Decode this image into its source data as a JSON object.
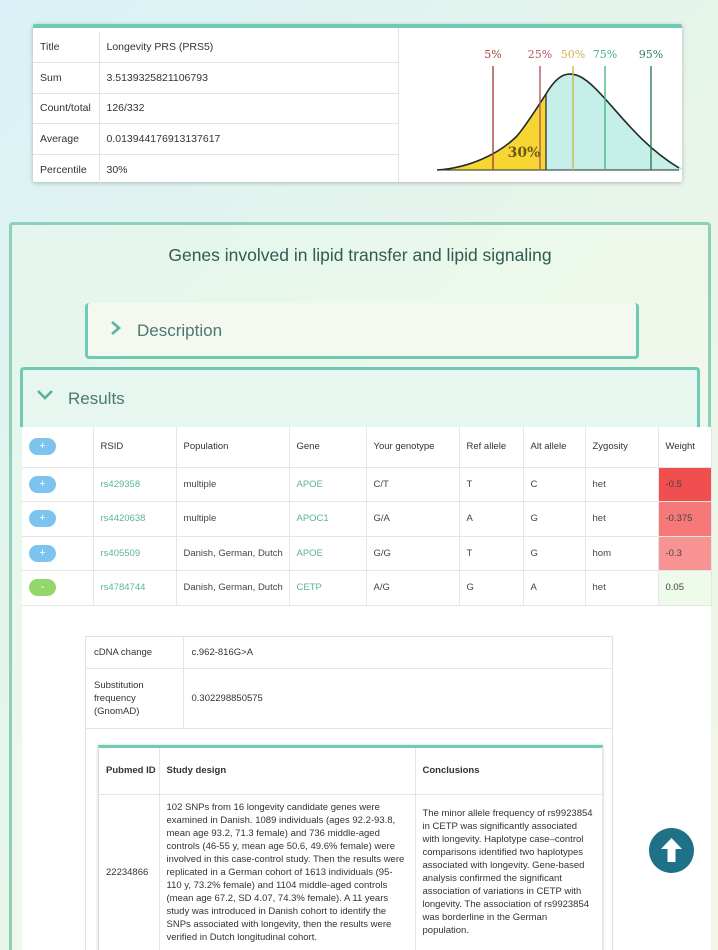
{
  "prs": {
    "rows": [
      {
        "label": "Title",
        "value": "Longevity PRS (PRS5)"
      },
      {
        "label": "Sum",
        "value": "3.5139325821106793"
      },
      {
        "label": "Count/total",
        "value": "126/332"
      },
      {
        "label": "Average",
        "value": "0.013944176913137617"
      },
      {
        "label": "Percentile",
        "value": "30%"
      }
    ],
    "chart": {
      "percentile_labels": [
        "5%",
        "25%",
        "50%",
        "75%",
        "95%"
      ],
      "percentile_colors": [
        "#a8433a",
        "#b4585f",
        "#cdb54a",
        "#46b582",
        "#2f7c55"
      ],
      "highlight_label": "30%",
      "highlight_fraction": 0.3,
      "fill_left": "#f7d633",
      "fill_right": "#c5efe8"
    }
  },
  "section": {
    "title": "Genes involved in lipid transfer and lipid signaling",
    "description_label": "Description",
    "results_label": "Results"
  },
  "results": {
    "headers": {
      "toggle": "+",
      "rsid": "RSID",
      "population": "Population",
      "gene": "Gene",
      "genotype": "Your genotype",
      "ref": "Ref allele",
      "alt": "Alt allele",
      "zygosity": "Zygosity",
      "weight": "Weight"
    },
    "rows": [
      {
        "toggle": "+",
        "rsid": "rs429358",
        "population": "multiple",
        "gene": "APOE",
        "genotype": "C/T",
        "ref": "T",
        "alt": "C",
        "zygosity": "het",
        "weight": "-0.5",
        "weight_color": "#f14f4f"
      },
      {
        "toggle": "+",
        "rsid": "rs4420638",
        "population": "multiple",
        "gene": "APOC1",
        "genotype": "G/A",
        "ref": "A",
        "alt": "G",
        "zygosity": "het",
        "weight": "-0.375",
        "weight_color": "#f67878"
      },
      {
        "toggle": "+",
        "rsid": "rs405509",
        "population": "Danish, German, Dutch",
        "gene": "APOE",
        "genotype": "G/G",
        "ref": "T",
        "alt": "G",
        "zygosity": "hom",
        "weight": "-0.3",
        "weight_color": "#f89393"
      },
      {
        "toggle": "-",
        "rsid": "rs4784744",
        "population": "Danish, German, Dutch",
        "gene": "CETP",
        "genotype": "A/G",
        "ref": "G",
        "alt": "A",
        "zygosity": "het",
        "weight": "0.05",
        "weight_color": "#eefaea"
      }
    ]
  },
  "detail": {
    "cdna_label": "cDNA change",
    "cdna_value": "c.962-816G>A",
    "freq_label": "Substitution frequency (GnomAD)",
    "freq_value": "0.302298850575",
    "pub_headers": {
      "id": "Pubmed ID",
      "design": "Study design",
      "conclusions": "Conclusions"
    },
    "pub_row": {
      "id": "22234866",
      "design": "102 SNPs from 16 longevity candidate genes were examined in Danish. 1089 individuals (ages 92.2-93.8, mean age 93.2, 71.3 female) and 736 middle-aged controls (46-55 y, mean age 50.6, 49.6% female) were involved in this case-control study. Then the results were replicated in a German cohort of 1613 individuals (95-110 y, 73.2% female) and 1104 middle-aged controls (mean age 67.2, SD 4.07, 74.3% female). A 11 years study was introduced in Danish cohort to identify the SNPs associated with longevity, then the results were verified in Dutch longitudinal cohort.",
      "conclusions": "The minor allele frequency of rs9923854 in CETP was significantly associated with longevity. Haplotype case–control comparisons identified two haplotypes associated with longevity. Gene-based analysis confirmed the significant association of variations in CETP with longevity. The association of rs9923854 was borderline in the German population."
    }
  }
}
